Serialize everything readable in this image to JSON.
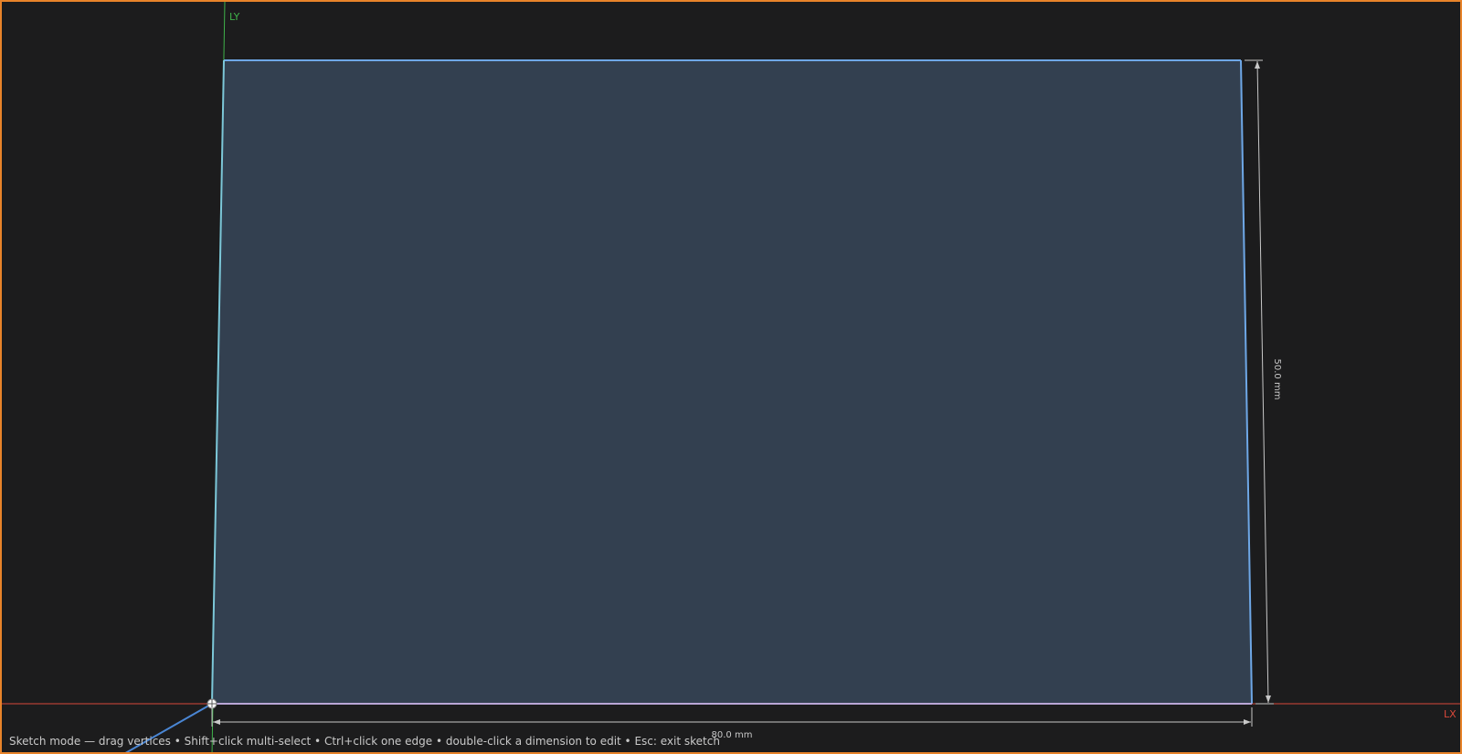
{
  "viewport": {
    "frame_color": "#e8832a",
    "background": "#1c1c1d"
  },
  "axes": {
    "y_label": "LY",
    "x_label": "LX",
    "y_color": "#3fb24a",
    "x_color": "#d8483a"
  },
  "sketch": {
    "profile_fill": "#334050",
    "edge_color": "#6ea7e6",
    "left_edge_color": "#7cc7d8",
    "bottom_edge_color": "#b9a6d6"
  },
  "dimensions": {
    "width_label": "80.0 mm",
    "height_label": "50.0 mm",
    "color": "#c8c8c8"
  },
  "status_hint": "Sketch mode — drag vertices • Shift+click multi-select • Ctrl+click one edge • double-click a dimension to edit • Esc: exit sketch"
}
